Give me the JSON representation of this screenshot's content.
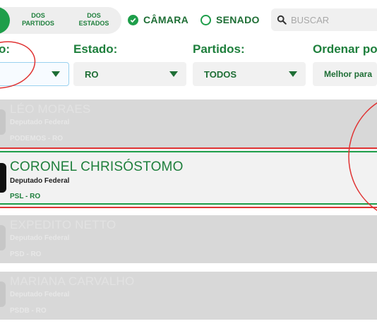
{
  "topbar": {
    "segment": {
      "items": [
        {
          "label": "DOS PARTIDOS"
        },
        {
          "label": "DOS ESTADOS"
        }
      ]
    },
    "house": {
      "camara_label": "CÂMARA",
      "senado_label": "SENADO",
      "selected": "CÂMARA"
    },
    "search": {
      "placeholder": "BUSCAR"
    }
  },
  "filters": {
    "first_label_fragment": "o:",
    "estado_label": "Estado:",
    "estado_value": "RO",
    "partidos_label": "Partidos:",
    "partidos_value": "TODOS",
    "ordenar_label": "Ordenar po",
    "ordenar_value": "Melhor para"
  },
  "results": [
    {
      "name": "LÉO MORAES",
      "role": "Deputado Federal",
      "party": "PODEMOS - RO",
      "state": "faded"
    },
    {
      "name": "CORONEL CHRISÓSTOMO",
      "role": "Deputado Federal",
      "party": "PSL - RO",
      "state": "highlighted"
    },
    {
      "name": "EXPEDITO NETTO",
      "role": "Deputado Federal",
      "party": "PSD - RO",
      "state": "faded"
    },
    {
      "name": "MARIANA CARVALHO",
      "role": "Deputado Federal",
      "party": "PSDB - RO",
      "state": "faded"
    }
  ],
  "colors": {
    "brand_green": "#1e9e4a",
    "annotation_red": "#e03333"
  }
}
